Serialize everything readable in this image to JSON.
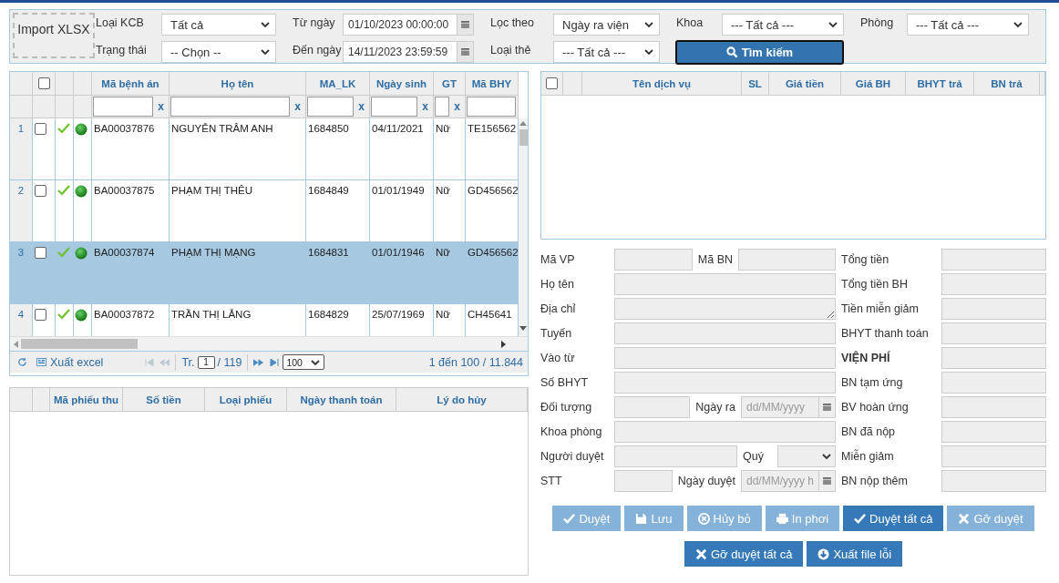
{
  "import_button": "Import XLSX",
  "filters": [
    {
      "label": "Loại KCB",
      "kind": "select",
      "value": "Tất cả"
    },
    {
      "label": "Từ ngày",
      "kind": "date",
      "value": "01/10/2023 00:00:00"
    },
    {
      "label": "Lọc theo",
      "kind": "select",
      "value": "Ngày ra viện"
    },
    {
      "label": "Khoa",
      "kind": "select",
      "value": "--- Tất cả ---"
    },
    {
      "label": "Phòng",
      "kind": "select",
      "value": "--- Tất cả ---"
    },
    {
      "label": "Trạng thái",
      "kind": "select",
      "value": "-- Chọn --"
    },
    {
      "label": "Đến ngày",
      "kind": "date",
      "value": "14/11/2023 23:59:59"
    },
    {
      "label": "Loại thẻ",
      "kind": "select",
      "value": "--- Tất cả ---"
    }
  ],
  "search_button": "Tìm kiếm",
  "record_grid": {
    "select_all": false,
    "columns": [
      {
        "label": "Mã bệnh án",
        "filter_clear": "x"
      },
      {
        "label": "Họ tên",
        "filter_clear": "x"
      },
      {
        "label": "MA_LK",
        "filter_clear": "x"
      },
      {
        "label": "Ngày sinh",
        "filter_clear": "x"
      },
      {
        "label": "GT",
        "filter_clear": "x"
      },
      {
        "label": "Mã BHY"
      }
    ],
    "rows": [
      {
        "number": "1",
        "checked": false,
        "selected": false,
        "cells": [
          "BA00037876",
          "NGUYỄN TRÂM ANH",
          "1684850",
          "04/11/2021",
          "Nữ",
          "TE156562"
        ]
      },
      {
        "number": "2",
        "checked": false,
        "selected": false,
        "cells": [
          "BA00037875",
          "PHẠM THỊ THÊU",
          "1684849",
          "01/01/1949",
          "Nữ",
          "GD456562"
        ]
      },
      {
        "number": "3",
        "checked": false,
        "selected": true,
        "cells": [
          "BA00037874",
          "PHẠM THỊ MẠNG",
          "1684831",
          "01/01/1946",
          "Nữ",
          "GD456562"
        ]
      },
      {
        "number": "4",
        "checked": false,
        "selected": false,
        "cells": [
          "BA00037872",
          "TRẦN THỊ LẲNG",
          "1684829",
          "25/07/1969",
          "Nữ",
          "CH45641"
        ]
      }
    ],
    "pager": {
      "export_label": "Xuất excel",
      "page_label": "Tr.",
      "page": "1",
      "page_total": "/ 119",
      "page_size": "100",
      "range": "1 đến 100 / 11.844"
    }
  },
  "receipts_table": {
    "columns": [
      "Mã phiếu thu",
      "Số tiền",
      "Loại phiếu",
      "Ngày thanh toán",
      "Lý do hủy"
    ]
  },
  "services_table": {
    "select_all": false,
    "columns": [
      "Tên dịch vụ",
      "SL",
      "Giá tiền",
      "Giá BH",
      "BHYT trả",
      "BN trả"
    ]
  },
  "form": {
    "left": [
      {
        "kind": "pair",
        "label": "Mã VP",
        "second": {
          "label": "Mã BN",
          "kind": "text"
        }
      },
      {
        "kind": "text",
        "label": "Họ tên"
      },
      {
        "kind": "textarea",
        "label": "Địa chỉ"
      },
      {
        "kind": "text",
        "label": "Tuyến"
      },
      {
        "kind": "text",
        "label": "Vào từ"
      },
      {
        "kind": "text",
        "label": "Số BHYT"
      },
      {
        "kind": "pair",
        "label": "Đối tượng",
        "second": {
          "label": "Ngày ra",
          "kind": "date",
          "placeholder": "dd/MM/yyyy"
        }
      },
      {
        "kind": "text",
        "label": "Khoa phòng"
      },
      {
        "kind": "pair",
        "label": "Người duyệt",
        "second": {
          "label": "Quý",
          "kind": "select"
        }
      },
      {
        "kind": "pair",
        "label": "STT",
        "second": {
          "label": "Ngày duyệt",
          "kind": "date",
          "placeholder": "dd/MM/yyyy h"
        }
      }
    ],
    "right": [
      {
        "label": "Tổng tiền",
        "bold": false
      },
      {
        "label": "Tổng tiền BH",
        "bold": false
      },
      {
        "label": "Tiền miễn giảm",
        "bold": false
      },
      {
        "label": "BHYT thanh toán",
        "bold": false
      },
      {
        "label": "VIỆN PHÍ",
        "bold": true
      },
      {
        "label": "BN tạm ứng",
        "bold": false
      },
      {
        "label": "BV hoàn ứng",
        "bold": false
      },
      {
        "label": "BN đã nộp",
        "bold": false
      },
      {
        "label": "Miễn giảm",
        "bold": false
      },
      {
        "label": "BN nộp thêm",
        "bold": false
      }
    ]
  },
  "button_rows": [
    [
      {
        "label": "Duyệt",
        "kind": "check",
        "disabled": true
      },
      {
        "label": "Lưu",
        "kind": "save",
        "disabled": true
      },
      {
        "label": "Hủy bỏ",
        "kind": "cancel",
        "disabled": true
      },
      {
        "label": "In phơi",
        "kind": "print",
        "disabled": true
      },
      {
        "label": "Duyệt tất cả",
        "kind": "check",
        "disabled": false
      },
      {
        "label": "Gỡ duyệt",
        "kind": "times",
        "disabled": true
      }
    ],
    [
      {
        "label": "Gỡ duyệt tất cả",
        "kind": "times",
        "disabled": false
      },
      {
        "label": "Xuất file lỗi",
        "kind": "download",
        "disabled": false
      }
    ]
  ]
}
